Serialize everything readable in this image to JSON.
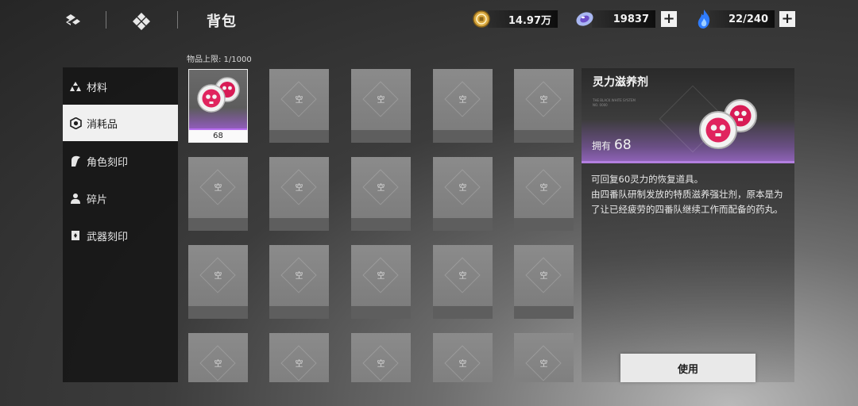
{
  "topbar": {
    "title": "背包",
    "currencies": [
      {
        "icon": "coin-icon",
        "value": "14.97万"
      },
      {
        "icon": "crystal-icon",
        "value": "19837"
      },
      {
        "icon": "blue-flame-icon",
        "value": "22/240"
      }
    ],
    "plus_label": "+"
  },
  "sidebar": {
    "items": [
      {
        "label": "材料",
        "icon": "material-icon"
      },
      {
        "label": "消耗品",
        "icon": "consumable-icon"
      },
      {
        "label": "角色刻印",
        "icon": "character-imprint-icon"
      },
      {
        "label": "碎片",
        "icon": "fragment-icon"
      },
      {
        "label": "武器刻印",
        "icon": "weapon-imprint-icon"
      }
    ],
    "active_index": 1
  },
  "inventory": {
    "capacity_label": "物品上限: 1/1000",
    "empty_label": "空",
    "filled_item_count": "68"
  },
  "detail": {
    "name": "灵力滋养剂",
    "fine_print_1": "THE BLACK WHITE SYSTEM",
    "fine_print_2": "NO. 0000",
    "owned_label": "拥有",
    "owned_count": "68",
    "description_1": "可回复60灵力的恢复道具。",
    "description_2": "由四番队研制发放的特质滋养强壮剂，原本是为了让已经疲劳的四番队继续工作而配备的药丸。"
  },
  "actions": {
    "use_label": "使用"
  },
  "colors": {
    "accent_purple": "#b37fe0",
    "item_pink": "#e0245e"
  }
}
